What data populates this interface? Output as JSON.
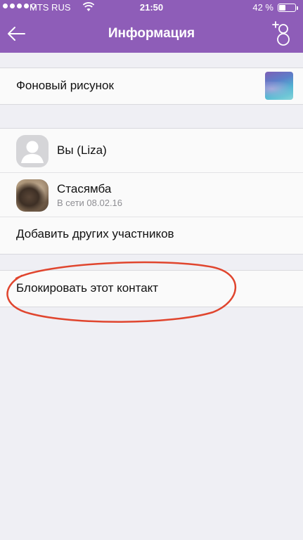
{
  "status_bar": {
    "carrier": "MTS RUS",
    "time": "21:50",
    "battery_percent": "42 %",
    "battery_level": 0.42,
    "signal_bars": 4
  },
  "nav": {
    "title": "Информация"
  },
  "wallpaper": {
    "label": "Фоновый рисунок"
  },
  "participants": [
    {
      "name": "Вы (Liza)",
      "status": ""
    },
    {
      "name": "Стасямба",
      "status": "В сети 08.02.16"
    }
  ],
  "add_participants": {
    "label": "Добавить других участников"
  },
  "block": {
    "label": "Блокировать этот контакт"
  },
  "colors": {
    "header": "#8e5db8",
    "background": "#efeff4",
    "annotation": "#e0452e"
  },
  "icons": [
    "back-arrow-icon",
    "add-participant-icon",
    "wifi-icon",
    "battery-icon",
    "default-avatar-icon"
  ]
}
